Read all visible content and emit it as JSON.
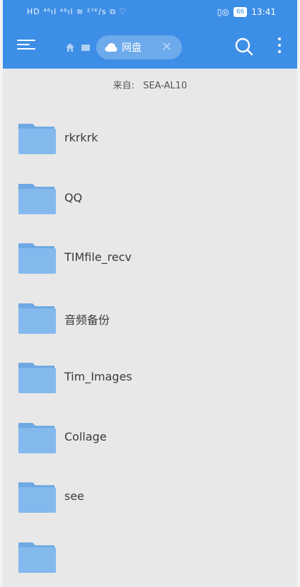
{
  "status_bar": {
    "left_indicators": "HD ⁴⁶ıl ⁴⁶ıl ≋ ²⁷ᴷ/s ⧉ ♡",
    "battery": "66",
    "time": "13:41"
  },
  "toolbar": {
    "breadcrumb_label": "网盘"
  },
  "source": {
    "label": "来自:",
    "device": "SEA-AL10"
  },
  "folders": [
    {
      "name": "rkrkrk"
    },
    {
      "name": "QQ"
    },
    {
      "name": "TIMfile_recv"
    },
    {
      "name": "音频备份"
    },
    {
      "name": "Tim_Images"
    },
    {
      "name": "Collage"
    },
    {
      "name": "see"
    },
    {
      "name": ""
    }
  ],
  "colors": {
    "header": "#3d8ee6",
    "folder_back": "#6fa9e3",
    "folder_front": "#84b9ee",
    "background": "#e8e8e8"
  }
}
